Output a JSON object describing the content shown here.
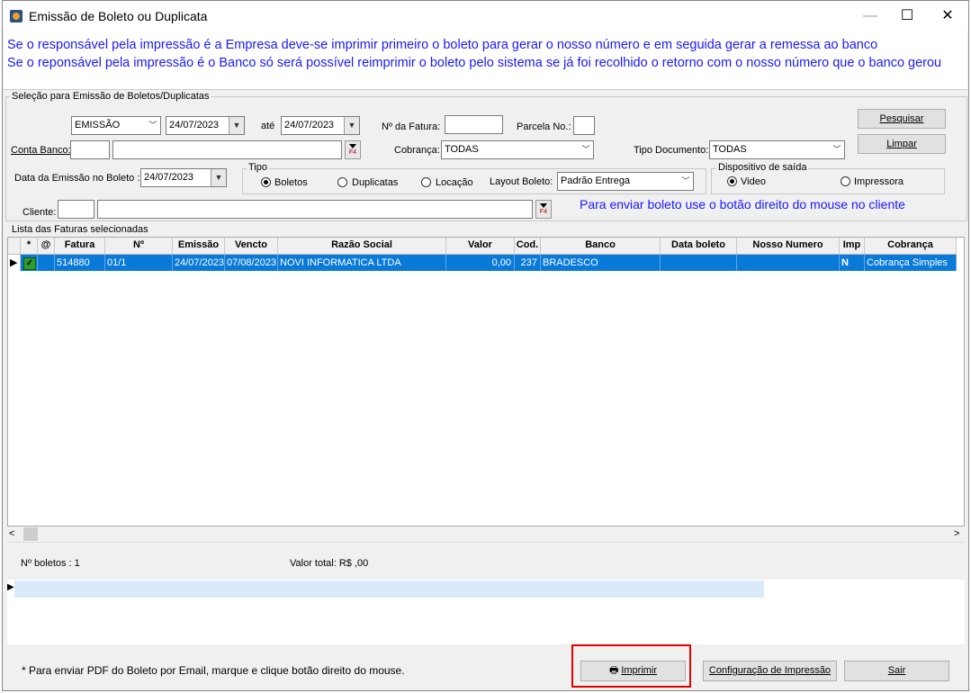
{
  "window": {
    "title": "Emissão de Boleto ou Duplicata",
    "minimize_glyph": "—",
    "maximize_glyph": "☐",
    "close_glyph": "✕"
  },
  "info": {
    "line1": "Se o responsável pela impressão é a Empresa deve-se imprimir primeiro o boleto para gerar o nosso número e em seguida gerar a remessa ao banco",
    "line2": "Se o reponsável pela impressão é o Banco só será possível reimprimir o boleto pelo sistema se já foi recolhido o retorno com o nosso número que o banco gerou"
  },
  "selection": {
    "group_title": "Seleção para Emissão de Boletos/Duplicatas",
    "date_type": "EMISSÃO",
    "date_from": "24/07/2023",
    "ate_label": "até",
    "date_to": "24/07/2023",
    "fatura_label": "Nº da Fatura:",
    "fatura_value": "",
    "parcela_label": "Parcela No.:",
    "parcela_value": "",
    "conta_banco_label": "Conta Banco:",
    "conta_banco_code": "",
    "conta_banco_name": "",
    "f4_label": "F4",
    "cobranca_label": "Cobrança:",
    "cobranca_value": "TODAS",
    "tipo_doc_label": "Tipo Documento:",
    "tipo_doc_value": "TODAS",
    "data_emissao_label": "Data da Emissão no Boleto :",
    "data_emissao_value": "24/07/2023",
    "tipo_group": "Tipo",
    "tipo_options": [
      "Boletos",
      "Duplicatas",
      "Locação"
    ],
    "tipo_selected": "Boletos",
    "layout_label": "Layout Boleto:",
    "layout_value": "Padrão Entrega",
    "dispositivo_group": "Dispositivo de saída",
    "dispositivo_options": [
      "Video",
      "Impressora"
    ],
    "dispositivo_selected": "Video",
    "cliente_label": "Cliente:",
    "cliente_code": "",
    "cliente_name": "",
    "hint": "Para enviar boleto use o botão direito do mouse no cliente",
    "pesquisar": "Pesquisar",
    "limpar": "Limpar"
  },
  "list": {
    "group_title": "Lista das Faturas selecionadas",
    "columns": [
      "*",
      "@",
      "Fatura",
      "Nº",
      "Emissão",
      "Vencto",
      "Razão Social",
      "Valor",
      "Cod.",
      "Banco",
      "Data boleto",
      "Nosso Numero",
      "Imp",
      "Cobrança"
    ],
    "rows": [
      {
        "checked": "✓",
        "at": "",
        "fatura": "514880",
        "numero": "01/1",
        "emissao": "24/07/2023",
        "vencto": "07/08/2023",
        "razao": "NOVI INFORMATICA LTDA",
        "valor": "0,00",
        "cod": "237",
        "banco": "BRADESCO",
        "data_boleto": "",
        "nosso_numero": "",
        "imp": "N",
        "cobranca": "Cobrança Simples"
      }
    ]
  },
  "totals": {
    "boletos": "Nº boletos : 1",
    "valor_total": "Valor total: R$ ,00"
  },
  "bottom": {
    "note": "* Para enviar PDF do  Boleto por Email, marque e clique botão direito do mouse.",
    "imprimir": "Imprimir",
    "config": "Configuração de Impressão",
    "sair": "Sair"
  },
  "colors": {
    "info_text": "#1a1aff",
    "row_selected": "#0a7ad8",
    "highlight_box": "#e00000"
  }
}
